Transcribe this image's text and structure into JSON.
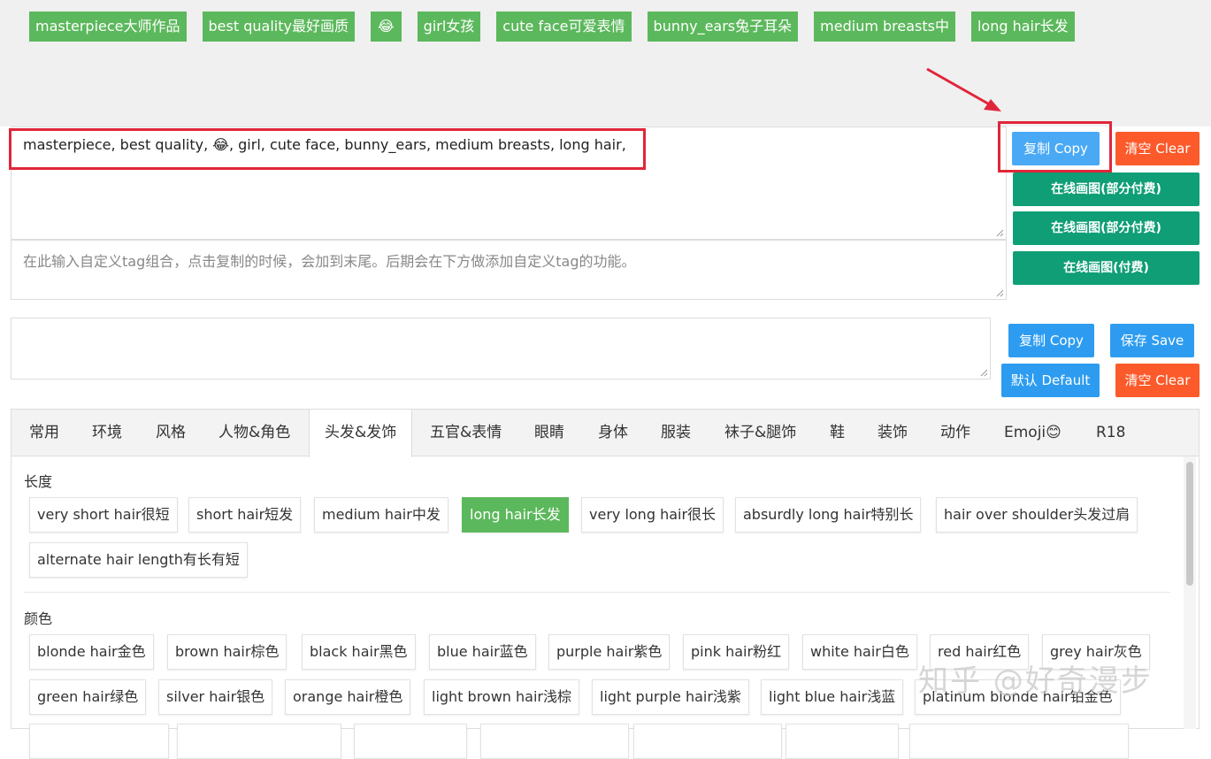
{
  "selected_tags": [
    "masterpiece大师作品",
    "best quality最好画质",
    "😂",
    "girl女孩",
    "cute face可爱表情",
    "bunny_ears兔子耳朵",
    "medium breasts中",
    "long hair长发"
  ],
  "prompt_text": "masterpiece, best quality, 😂, girl, cute face, bunny_ears, medium breasts, long hair,",
  "custom_placeholder": "在此输入自定义tag组合，点击复制的时候，会加到末尾。后期会在下方做添加自定义tag的功能。",
  "buttons": {
    "copy": "复制 Copy",
    "clear": "清空 Clear",
    "online_partial_1": "在线画图(部分付费)",
    "online_partial_2": "在线画图(部分付费)",
    "online_paid": "在线画图(付费)",
    "copy2": "复制 Copy",
    "save": "保存 Save",
    "default": "默认 Default",
    "clear2": "清空 Clear"
  },
  "tabs": [
    "常用",
    "环境",
    "风格",
    "人物&角色",
    "头发&发饰",
    "五官&表情",
    "眼睛",
    "身体",
    "服装",
    "袜子&腿饰",
    "鞋",
    "装饰",
    "动作",
    "Emoji😊",
    "R18"
  ],
  "active_tab": "头发&发饰",
  "sections": {
    "length": {
      "label": "长度",
      "options": [
        "very short hair很短",
        "short hair短发",
        "medium hair中发",
        "long hair长发",
        "very long hair很长",
        "absurdly long hair特别长",
        "hair over shoulder头发过肩",
        "alternate hair length有长有短"
      ]
    },
    "color": {
      "label": "颜色",
      "options": [
        "blonde hair金色",
        "brown hair棕色",
        "black hair黑色",
        "blue hair蓝色",
        "purple hair紫色",
        "pink hair粉红",
        "white hair白色",
        "red hair红色",
        "grey hair灰色",
        "green hair绿色",
        "silver hair银色",
        "orange hair橙色",
        "light brown hair浅棕",
        "light purple hair浅紫",
        "light blue hair浅蓝",
        "platinum blonde hair铂金色"
      ]
    }
  },
  "watermark": "知乎 @好奇漫步",
  "colors": {
    "tag_green": "#5cb85c",
    "btn_blue": "#2d9cf0",
    "btn_orange": "#fc5a2a",
    "btn_teal": "#0f9e76",
    "highlight_red": "#e0263a"
  }
}
